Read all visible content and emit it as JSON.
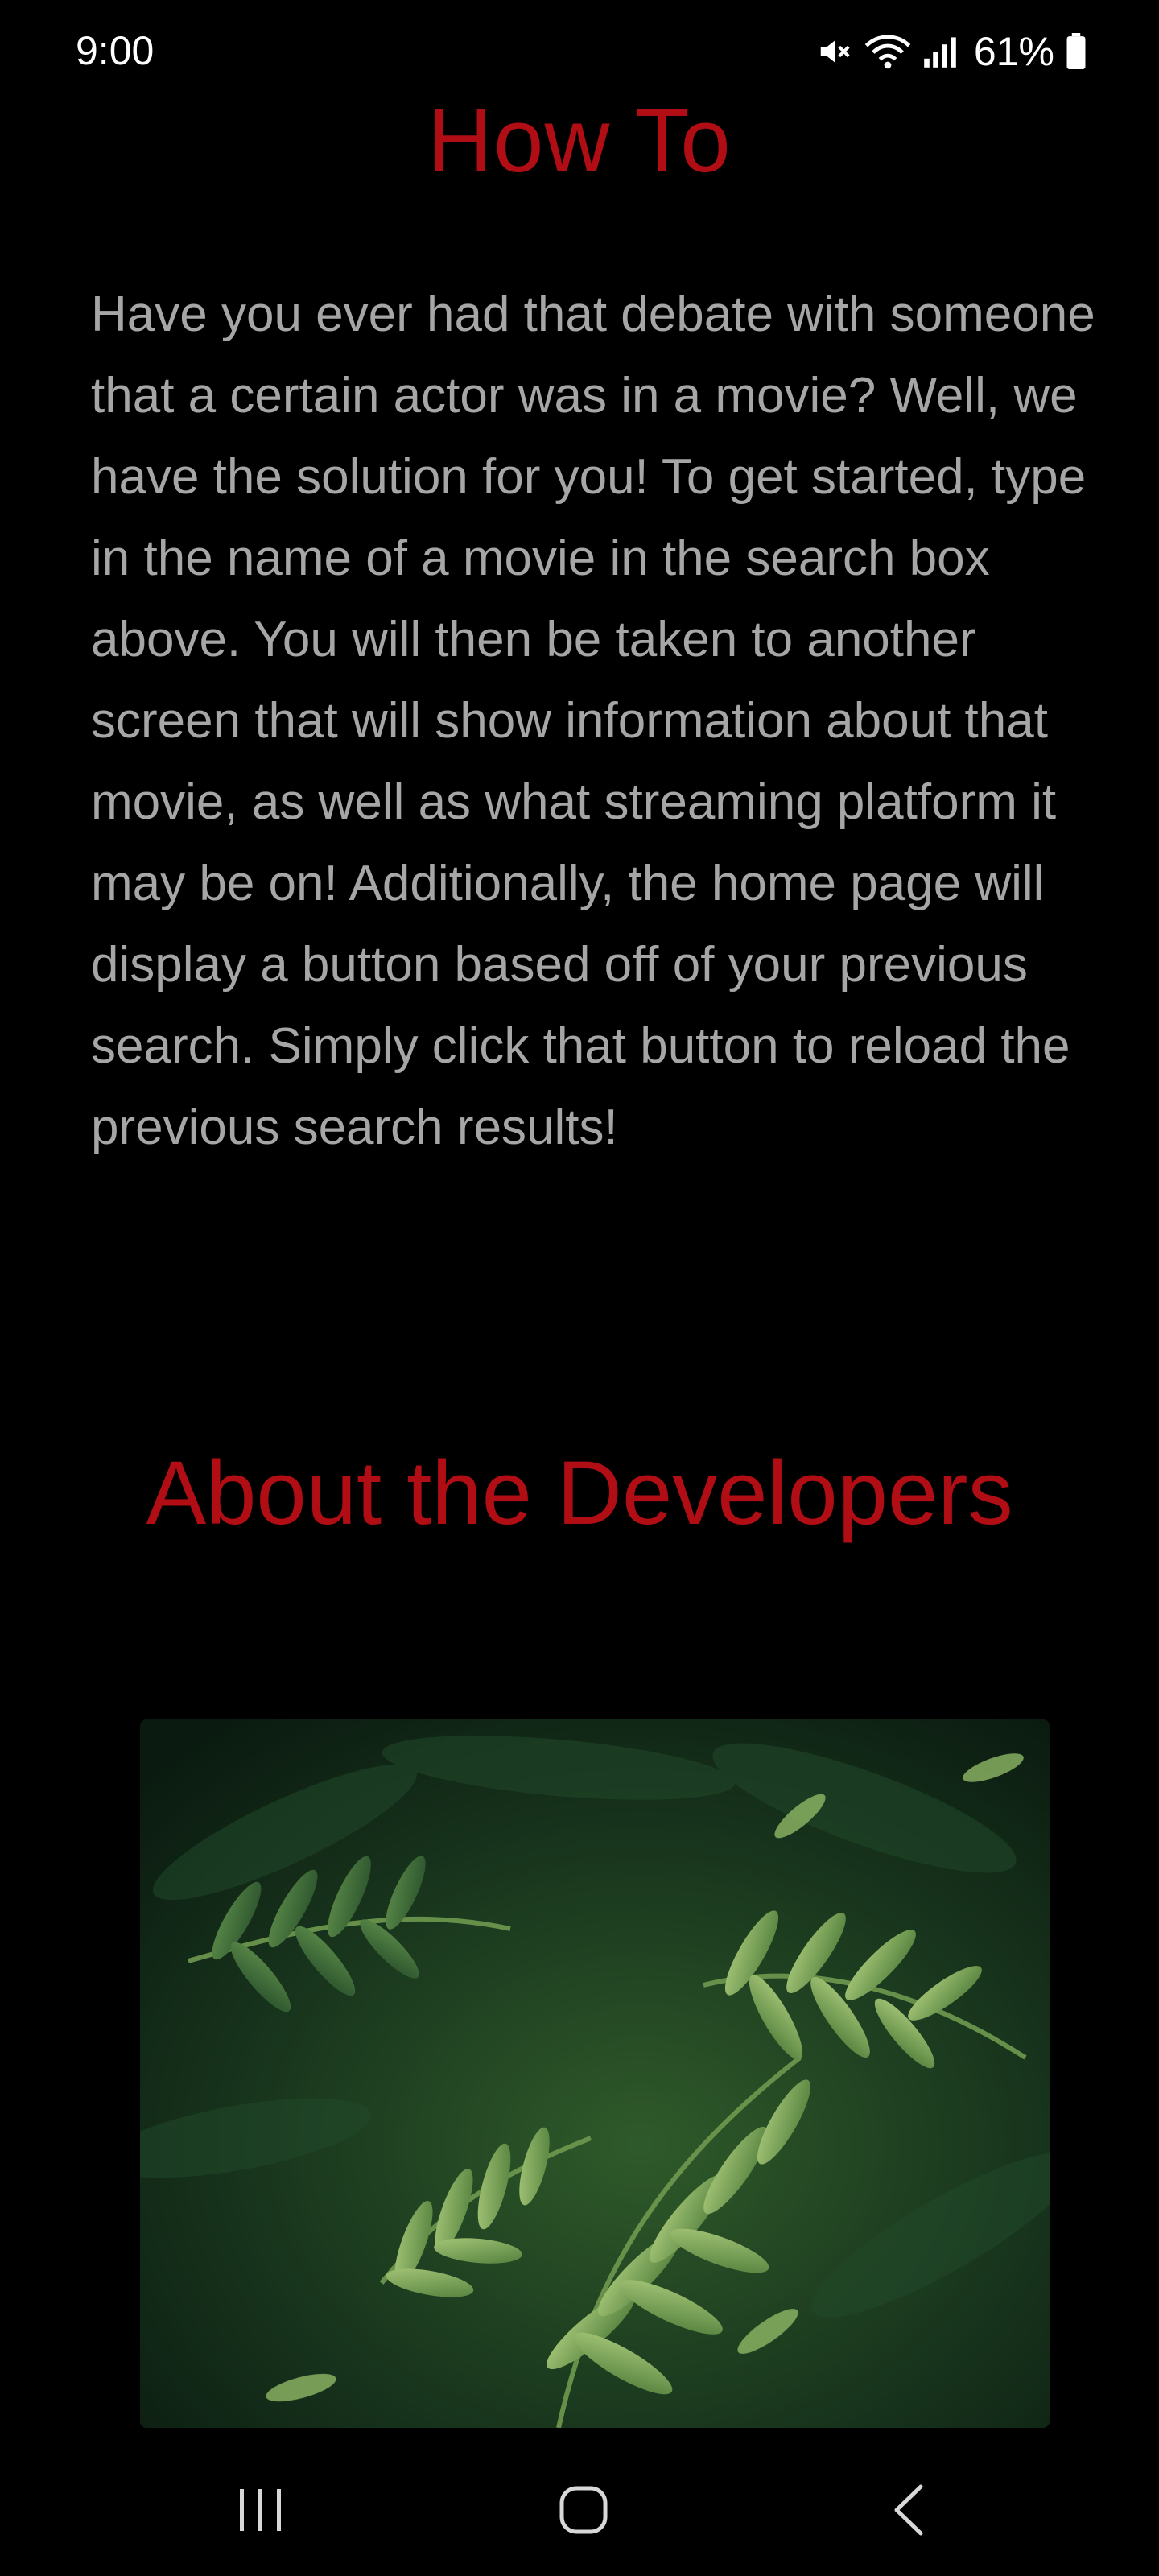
{
  "status_bar": {
    "time": "9:00",
    "battery_percent": "61%",
    "icons": [
      "mute-icon",
      "wifi-icon",
      "signal-icon",
      "battery-icon"
    ]
  },
  "how_to": {
    "title": "How To",
    "body": "Have you ever had that debate with someone that a certain actor was in a movie? Well, we have the solution for you! To get started, type in the name of a movie in the search box above. You will then be taken to another screen that will show information about that movie, as well as what streaming platform it may be on! Additionally, the home page will display a button based off of your previous search. Simply click that button to reload the previous search results!"
  },
  "about": {
    "title": "About the Developers"
  },
  "nav_bar": {
    "buttons": [
      "recent-apps-icon",
      "home-icon",
      "back-icon"
    ]
  },
  "colors": {
    "background": "#000000",
    "heading": "#b00d14",
    "body_text": "#a6a6a6"
  }
}
